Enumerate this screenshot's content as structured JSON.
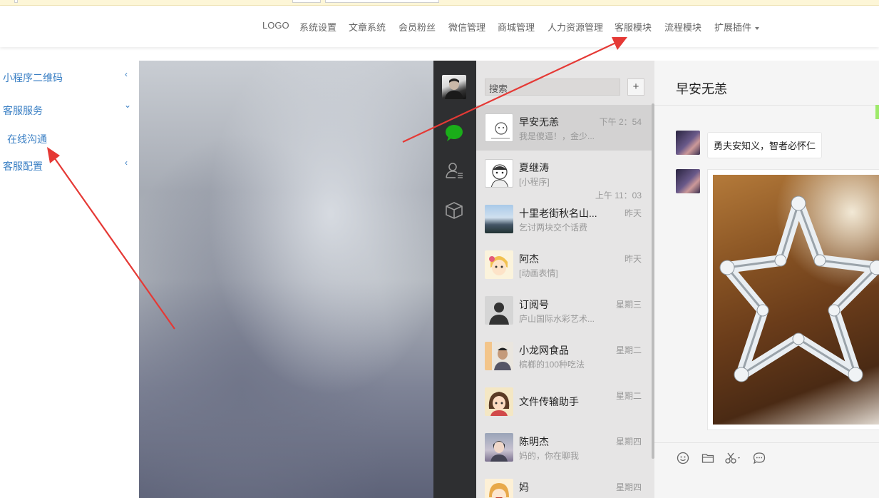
{
  "topnav": {
    "items": [
      "LOGO",
      "系统设置",
      "文章系统",
      "会员粉丝",
      "微信管理",
      "商城管理",
      "人力资源管理",
      "客服模块",
      "流程模块",
      "扩展插件"
    ]
  },
  "sidebar": {
    "items": [
      {
        "label": "小程序二维码",
        "chevron": "‹"
      },
      {
        "label": "客服服务",
        "chevron": "⌄"
      },
      {
        "label": "在线沟通"
      },
      {
        "label": "客服配置",
        "chevron": "‹"
      }
    ]
  },
  "wechat": {
    "search_placeholder": "搜索",
    "plus_label": "+",
    "conversations": [
      {
        "name": "早安无恙",
        "message": "我是傻逼！，金少...",
        "time": "下午 2：54"
      },
      {
        "name": "夏继涛",
        "message": "[小程序]",
        "time": "上午 11：03"
      },
      {
        "name": "十里老街秋名山...",
        "message": "乞讨两块交个话费",
        "time": "昨天"
      },
      {
        "name": "阿杰",
        "message": "[动画表情]",
        "time": "昨天"
      },
      {
        "name": "订阅号",
        "message": "庐山国际水彩艺术...",
        "time": "星期三"
      },
      {
        "name": "小龙网食品",
        "message": "槟榔的100种吃法",
        "time": "星期二"
      },
      {
        "name": "文件传输助手",
        "message": "",
        "time": "星期二"
      },
      {
        "name": "陈明杰",
        "message": "妈的，你在聊我",
        "time": "星期四"
      },
      {
        "name": "妈",
        "message": "",
        "time": "星期四"
      }
    ],
    "chat": {
      "title": "早安无恙",
      "text_message": "勇夫安知义，智者必怀仁"
    }
  },
  "colors": {
    "accent_link": "#3a7fc4",
    "annotation_arrow": "#e53935",
    "wechat_green": "#1aad19"
  }
}
